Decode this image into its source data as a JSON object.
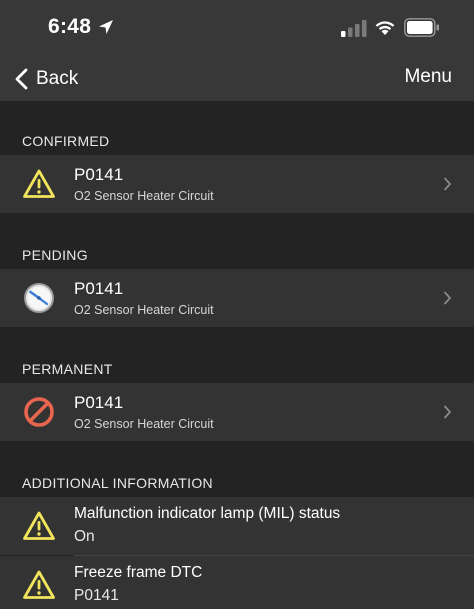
{
  "status_bar": {
    "time": "6:48"
  },
  "nav": {
    "back_label": "Back",
    "menu_label": "Menu"
  },
  "sections": {
    "confirmed": {
      "header": "CONFIRMED",
      "code": "P0141",
      "description": "O2 Sensor Heater Circuit",
      "icon": "warning-triangle-icon",
      "icon_color": "#f2e55c"
    },
    "pending": {
      "header": "PENDING",
      "code": "P0141",
      "description": "O2 Sensor Heater Circuit",
      "icon": "clock-icon",
      "icon_color": "#3a7bd5"
    },
    "permanent": {
      "header": "PERMANENT",
      "code": "P0141",
      "description": "O2 Sensor Heater Circuit",
      "icon": "prohibited-icon",
      "icon_color": "#e8664f"
    }
  },
  "additional": {
    "header": "ADDITIONAL INFORMATION",
    "items": [
      {
        "label": "Malfunction indicator lamp (MIL) status",
        "value": "On",
        "icon": "warning-triangle-icon"
      },
      {
        "label": "Freeze frame DTC",
        "value": "P0141",
        "icon": "warning-triangle-icon"
      }
    ]
  }
}
